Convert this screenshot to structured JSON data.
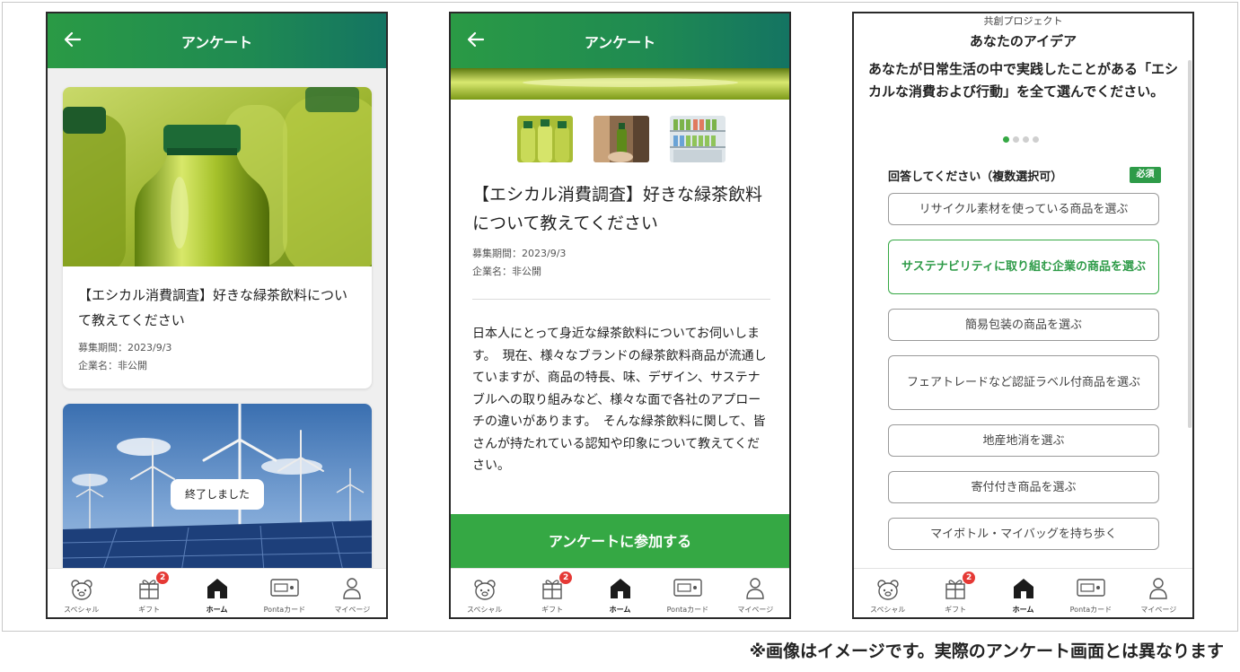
{
  "colors": {
    "accent": "#35a844",
    "header_gradient_start": "#2a9a45",
    "header_gradient_end": "#147462",
    "badge": "#e53935"
  },
  "caption": "※画像はイメージです。実際のアンケート画面とは異なります",
  "nav": {
    "items": [
      {
        "label": "スペシャル",
        "icon": "bear-icon"
      },
      {
        "label": "ギフト",
        "icon": "gift-icon",
        "badge": "2"
      },
      {
        "label": "ホーム",
        "icon": "home-icon"
      },
      {
        "label": "Pontaカード",
        "icon": "card-icon"
      },
      {
        "label": "マイページ",
        "icon": "person-icon"
      }
    ]
  },
  "screen1": {
    "header_title": "アンケート",
    "cards": [
      {
        "title": "【エシカル消費調査】好きな緑茶飲料について教えてください",
        "period": "募集期間：2023/9/3",
        "company": "企業名：非公開"
      },
      {
        "status": "終了しました"
      }
    ]
  },
  "screen2": {
    "header_title": "アンケート",
    "title": "【エシカル消費調査】好きな緑茶飲料について教えてください",
    "period": "募集期間：2023/9/3",
    "company": "企業名：非公開",
    "body": "日本人にとって身近な緑茶飲料についてお伺いします。　現在、様々なブランドの緑茶飲料商品が流通していますが、商品の特長、味、デザイン、サステナブルへの取り組みなど、様々な面で各社のアプローチの違いがあります。　そんな緑茶飲料に関して、皆さんが持たれている認知や印象について教えてください。",
    "join_button": "アンケートに参加する"
  },
  "screen3": {
    "subtitle": "共創プロジェクト",
    "header_title": "あなたのアイデア",
    "question": "あなたが日常生活の中で実践したことがある「エシカルな消費および行動」を全て選んでください。",
    "answer_label": "回答してください（複数選択可）",
    "required_badge": "必須",
    "options": [
      {
        "label": "リサイクル素材を使っている商品を選ぶ",
        "selected": false
      },
      {
        "label": "サステナビリティに取り組む企業の商品を選ぶ",
        "selected": true
      },
      {
        "label": "簡易包装の商品を選ぶ",
        "selected": false
      },
      {
        "label": "フェアトレードなど認証ラベル付商品を選ぶ",
        "selected": false
      },
      {
        "label": "地産地消を選ぶ",
        "selected": false
      },
      {
        "label": "寄付付き商品を選ぶ",
        "selected": false
      },
      {
        "label": "マイボトル・マイバッグを持ち歩く",
        "selected": false
      }
    ]
  }
}
